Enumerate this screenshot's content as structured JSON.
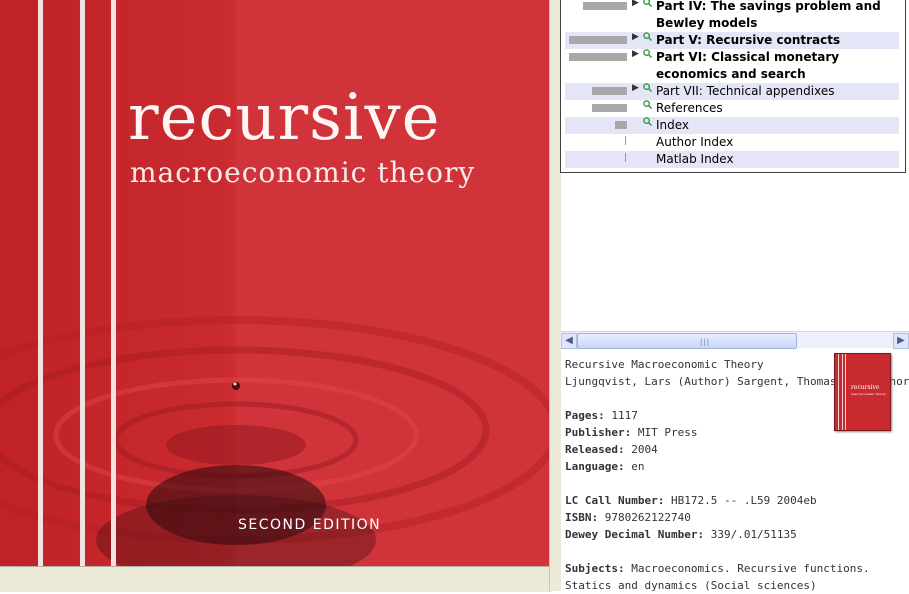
{
  "cover": {
    "title": "recursive",
    "subtitle": "macroeconomic theory",
    "edition": "SECOND EDITION"
  },
  "toc": {
    "items": [
      {
        "label": "Part IV: The savings problem and Bewley models",
        "bold": true
      },
      {
        "label": "Part V: Recursive contracts",
        "bold": true
      },
      {
        "label": "Part VI: Classical monetary economics and search",
        "bold": true
      },
      {
        "label": "Part VII: Technical appendixes",
        "bold": false
      },
      {
        "label": "References",
        "bold": false
      },
      {
        "label": "Index",
        "bold": false
      },
      {
        "label": "Author Index",
        "bold": false
      },
      {
        "label": "Matlab Index",
        "bold": false
      }
    ]
  },
  "details": {
    "title": "Recursive Macroeconomic Theory",
    "authors": "Ljungqvist, Lars (Author) Sargent, Thomas J. (Author)",
    "pages_label": "Pages:",
    "pages": "1117",
    "publisher_label": "Publisher:",
    "publisher": "MIT Press",
    "released_label": "Released:",
    "released": "2004",
    "language_label": "Language:",
    "language": "en",
    "lc_label": "LC Call Number:",
    "lc": "HB172.5 -- .L59 2004eb",
    "isbn_label": "ISBN:",
    "isbn": "9780262122740",
    "dewey_label": "Dewey Decimal Number:",
    "dewey": "339/.01/51135",
    "subjects_label": "Subjects:",
    "subjects": "Macroeconomics.  Recursive functions.  Statics and dynamics (Social sciences)"
  },
  "thumbnail": {
    "title": "recursive",
    "subtitle": "macroeconomic theory"
  },
  "colors": {
    "cover_red": "#c92a30",
    "toc_alt_row": "#e4e6f7"
  }
}
